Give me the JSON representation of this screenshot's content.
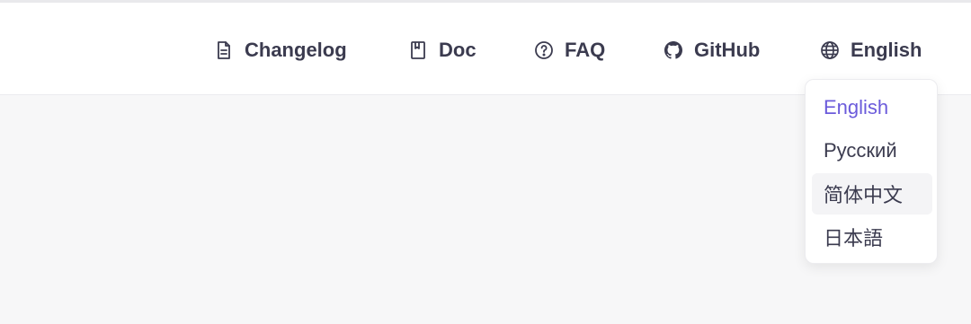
{
  "nav": {
    "changelog": {
      "label": "Changelog",
      "icon": "document-icon"
    },
    "doc": {
      "label": "Doc",
      "icon": "book-icon"
    },
    "faq": {
      "label": "FAQ",
      "icon": "question-circle-icon"
    },
    "github": {
      "label": "GitHub",
      "icon": "github-icon"
    },
    "language": {
      "label": "English",
      "icon": "globe-icon"
    }
  },
  "language_menu": {
    "items": [
      {
        "label": "English",
        "state": "selected"
      },
      {
        "label": "Русский",
        "state": "normal"
      },
      {
        "label": "简体中文",
        "state": "hovered"
      },
      {
        "label": "日本語",
        "state": "normal"
      }
    ]
  },
  "colors": {
    "accent": "#6b5bdb",
    "text": "#3b3b4f",
    "page_bg": "#f7f7f8",
    "navbar_bg": "#ffffff"
  }
}
